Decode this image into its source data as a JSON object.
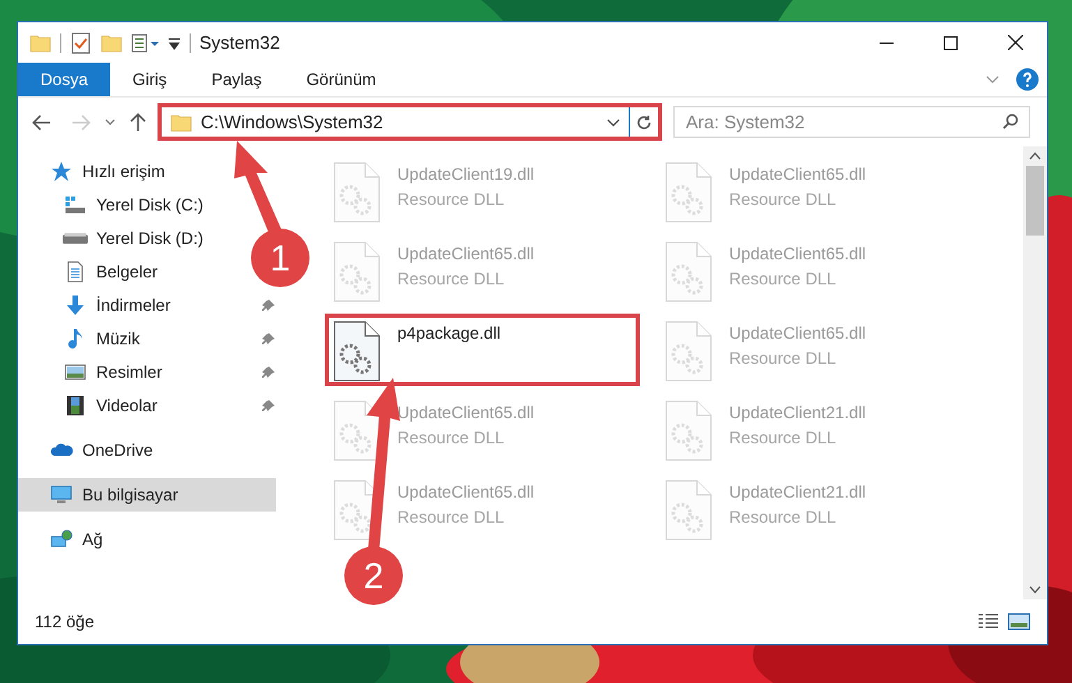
{
  "window": {
    "title": "System32"
  },
  "ribbon_tabs": [
    {
      "label": "Dosya",
      "selected": true
    },
    {
      "label": "Giriş",
      "selected": false
    },
    {
      "label": "Paylaş",
      "selected": false
    },
    {
      "label": "Görünüm",
      "selected": false
    }
  ],
  "address": {
    "path": "C:\\Windows\\System32",
    "highlighted": true
  },
  "search": {
    "placeholder": "Ara: System32"
  },
  "sidebar": {
    "groups": [
      {
        "kind": "star",
        "label": "Hızlı erişim",
        "selected": false,
        "children": [
          {
            "kind": "drive-c",
            "label": "Yerel Disk (C:)",
            "selected": false
          },
          {
            "kind": "drive",
            "label": "Yerel Disk (D:)",
            "selected": false
          },
          {
            "kind": "documents",
            "label": "Belgeler",
            "selected": false
          },
          {
            "kind": "downloads",
            "label": "İndirmeler",
            "pinned": true,
            "selected": false
          },
          {
            "kind": "music",
            "label": "Müzik",
            "pinned": true,
            "selected": false
          },
          {
            "kind": "pictures",
            "label": "Resimler",
            "pinned": true,
            "selected": false
          },
          {
            "kind": "videos",
            "label": "Videolar",
            "pinned": true,
            "selected": false
          }
        ]
      },
      {
        "kind": "cloud",
        "label": "OneDrive",
        "selected": false
      },
      {
        "kind": "pc",
        "label": "Bu bilgisayar",
        "selected": true
      },
      {
        "kind": "network",
        "label": "Ağ",
        "selected": false
      }
    ]
  },
  "files": [
    {
      "name": "UpdateClient19.dll",
      "type": "Resource DLL",
      "faded": true,
      "highlighted": false
    },
    {
      "name": "UpdateClient65.dll",
      "type": "Resource DLL",
      "faded": true,
      "highlighted": false
    },
    {
      "name": "UpdateClient65.dll",
      "type": "Resource DLL",
      "faded": true,
      "highlighted": false
    },
    {
      "name": "UpdateClient65.dll",
      "type": "Resource DLL",
      "faded": true,
      "highlighted": false
    },
    {
      "name": "p4package.dll",
      "faded": false,
      "highlighted": true
    },
    {
      "name": "UpdateClient65.dll",
      "type": "Resource DLL",
      "faded": true,
      "highlighted": false
    },
    {
      "name": "UpdateClient65.dll",
      "type": "Resource DLL",
      "faded": true,
      "highlighted": false
    },
    {
      "name": "UpdateClient21.dll",
      "type": "Resource DLL",
      "faded": true,
      "highlighted": false
    },
    {
      "name": "UpdateClient65.dll",
      "type": "Resource DLL",
      "faded": true,
      "highlighted": false
    },
    {
      "name": "UpdateClient21.dll",
      "type": "Resource DLL",
      "faded": true,
      "highlighted": false
    }
  ],
  "status_bar": {
    "item_count": "112 öğe"
  },
  "callouts": [
    {
      "label": "1"
    },
    {
      "label": "2"
    }
  ]
}
